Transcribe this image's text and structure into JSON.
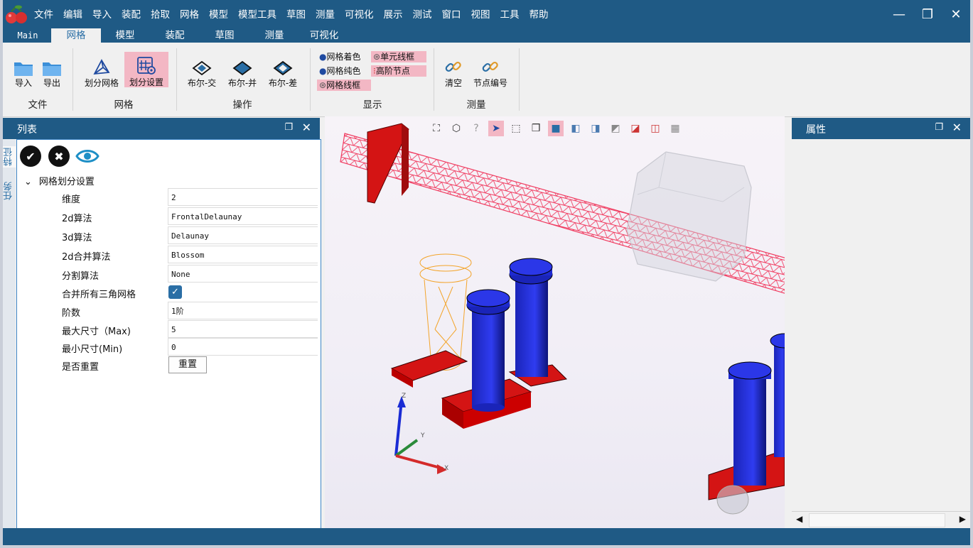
{
  "menu": [
    "文件",
    "编辑",
    "导入",
    "装配",
    "拾取",
    "网格",
    "模型",
    "模型工具",
    "草图",
    "测量",
    "可视化",
    "展示",
    "测试",
    "窗口",
    "视图",
    "工具",
    "帮助"
  ],
  "window_buttons": {
    "minimize": "—",
    "restore": "❐",
    "close": "✕"
  },
  "tabs": [
    "Main",
    "网格",
    "模型",
    "装配",
    "草图",
    "测量",
    "可视化"
  ],
  "active_tab": "网格",
  "ribbon": {
    "groups": [
      {
        "label": "文件",
        "buttons": [
          "导入",
          "导出"
        ]
      },
      {
        "label": "网格",
        "buttons": [
          "划分网格",
          "划分设置"
        ]
      },
      {
        "label": "操作",
        "buttons": [
          "布尔-交",
          "布尔-并",
          "布尔-差"
        ]
      },
      {
        "label": "显示",
        "buttons": [
          "网格着色",
          "网格纯色",
          "网格线框",
          "单元线框",
          "高阶节点"
        ]
      },
      {
        "label": "测量",
        "buttons": [
          "清空",
          "节点编号"
        ]
      }
    ]
  },
  "left_panel": {
    "title": "列表",
    "side_tabs": [
      "特征",
      "任务"
    ],
    "tree_title": "网格划分设置",
    "properties": [
      {
        "label": "维度",
        "value": "2"
      },
      {
        "label": "2d算法",
        "value": "FrontalDelaunay"
      },
      {
        "label": "3d算法",
        "value": "Delaunay"
      },
      {
        "label": "2d合并算法",
        "value": "Blossom"
      },
      {
        "label": "分割算法",
        "value": "None"
      },
      {
        "label": "合并所有三角网格",
        "value": "✓"
      },
      {
        "label": "阶数",
        "value": "1阶"
      },
      {
        "label": "最大尺寸（Max)",
        "value": "5"
      },
      {
        "label": "最小尺寸(Min)",
        "value": "0"
      },
      {
        "label": "是否重置",
        "value": "重置"
      }
    ]
  },
  "right_panel": {
    "title": "属性"
  },
  "axes": {
    "x": "X",
    "y": "Y",
    "z": "Z"
  },
  "colors": {
    "titlebar": "#1f5a85",
    "selected": "#f3b7c4",
    "accent": "#2a6ea5"
  }
}
